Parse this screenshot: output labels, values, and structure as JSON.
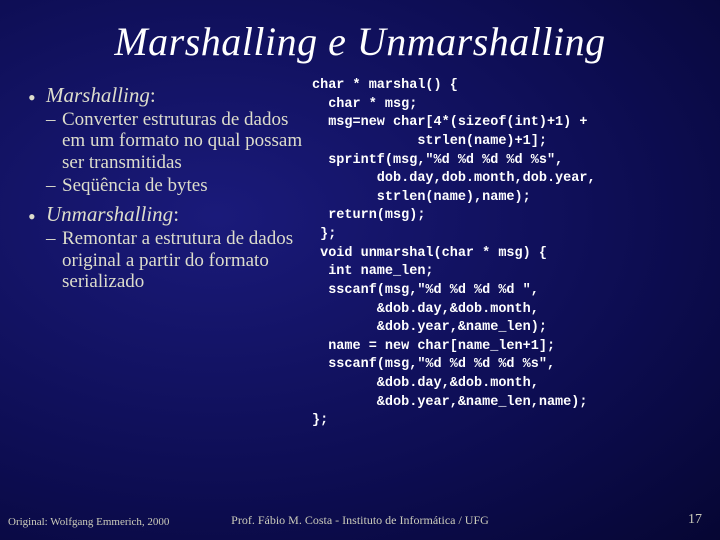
{
  "title": "Marshalling e Unmarshalling",
  "left": {
    "b1": "Marshalling",
    "b1_colon": ":",
    "b1_sub1": "Converter estruturas de dados em um formato no qual possam ser transmitidas",
    "b1_sub2": "Seqüência de bytes",
    "b2": "Unmarshalling",
    "b2_colon": ":",
    "b2_sub1": "Remontar a estrutura de dados original a partir do formato serializado"
  },
  "code": "char * marshal() {\n  char * msg;\n  msg=new char[4*(sizeof(int)+1) +\n             strlen(name)+1];\n  sprintf(msg,\"%d %d %d %d %s\",\n        dob.day,dob.month,dob.year,\n        strlen(name),name);\n  return(msg);\n };\n void unmarshal(char * msg) {\n  int name_len;\n  sscanf(msg,\"%d %d %d %d \",\n        &dob.day,&dob.month,\n        &dob.year,&name_len);\n  name = new char[name_len+1];\n  sscanf(msg,\"%d %d %d %d %s\",\n        &dob.day,&dob.month,\n        &dob.year,&name_len,name);\n};",
  "footer": {
    "left": "Original: Wolfgang Emmerich, 2000",
    "center": "Prof. Fábio M. Costa  -  Instituto de Informática / UFG",
    "right": "17"
  }
}
